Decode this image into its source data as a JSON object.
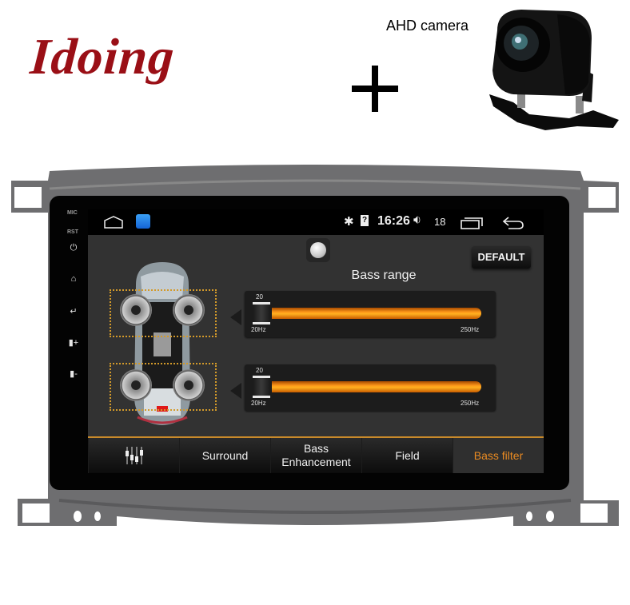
{
  "promo": {
    "brand": "Idoing",
    "camera_label": "AHD camera",
    "plus_icon": "plus-icon",
    "camera_image": "rear-camera-image"
  },
  "device": {
    "side_labels": {
      "mic": "MIC",
      "rst": "RST"
    },
    "side_buttons": [
      "power-icon",
      "home-icon",
      "back-icon",
      "volume-up-icon",
      "volume-down-icon"
    ]
  },
  "statusbar": {
    "time": "16:26",
    "volume": "18",
    "icons": [
      "home-outline-icon",
      "app-icon",
      "bluetooth-icon",
      "sim-unknown-icon",
      "volume-icon",
      "recents-icon",
      "back-arrow-icon"
    ]
  },
  "app": {
    "default_button": "DEFAULT",
    "section_title": "Bass range",
    "sliders": [
      {
        "name": "front-bass-range",
        "value_label": "20",
        "min_label": "20Hz",
        "max_label": "250Hz",
        "value_fraction": 0.0
      },
      {
        "name": "rear-bass-range",
        "value_label": "20",
        "min_label": "20Hz",
        "max_label": "250Hz",
        "value_fraction": 0.0
      }
    ],
    "zones": [
      "front-speaker-zone",
      "rear-speaker-zone"
    ]
  },
  "tabs": [
    {
      "label": "",
      "icon": "equalizer-icon",
      "active": false
    },
    {
      "label": "Surround",
      "active": false
    },
    {
      "label": "Bass\nEnhancement",
      "active": false
    },
    {
      "label": "Field",
      "active": false
    },
    {
      "label": "Bass filter",
      "active": true
    }
  ],
  "colors": {
    "brand_red": "#9a0f16",
    "accent_orange": "#e88a22",
    "slider_orange": "#ff9a1a",
    "app_bg": "#323232"
  }
}
